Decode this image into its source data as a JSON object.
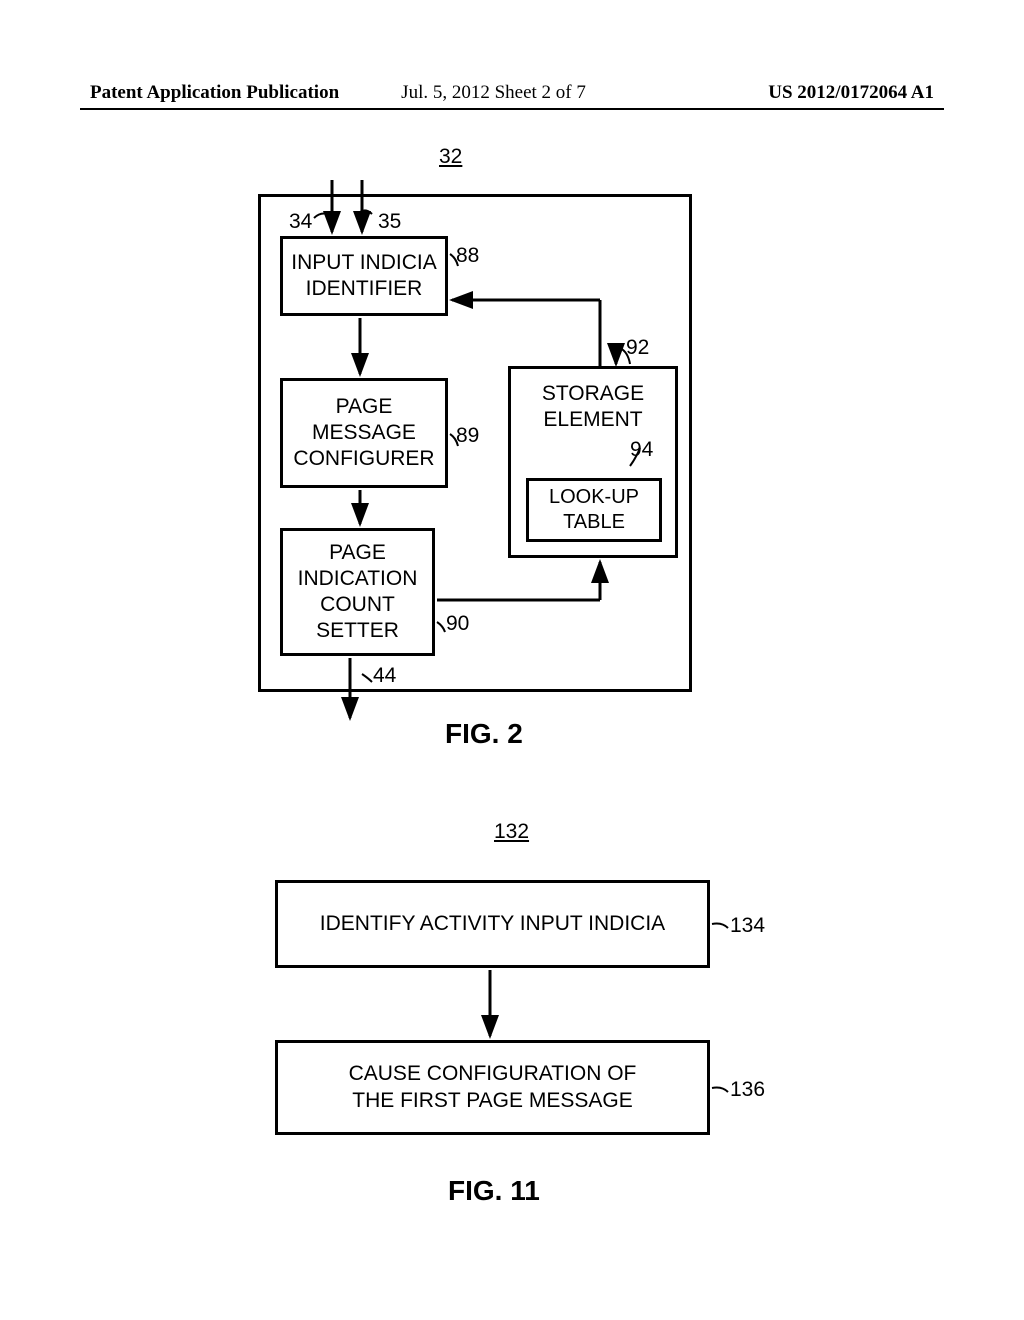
{
  "header": {
    "left": "Patent Application Publication",
    "center": "Jul. 5, 2012   Sheet 2 of 7",
    "right": "US 2012/0172064 A1"
  },
  "fig2": {
    "ref_main": "32",
    "ref_input1": "34",
    "ref_input2": "35",
    "ref_identifier": "88",
    "ref_configurer": "89",
    "ref_setter": "90",
    "ref_storage": "92",
    "ref_lookup": "94",
    "ref_output": "44",
    "box_identifier": "INPUT INDICIA\nIDENTIFIER",
    "box_configurer": "PAGE\nMESSAGE\nCONFIGURER",
    "box_setter": "PAGE\nINDICATION\nCOUNT\nSETTER",
    "box_storage": "STORAGE\nELEMENT",
    "box_lookup": "LOOK-UP\nTABLE",
    "caption": "FIG. 2"
  },
  "fig11": {
    "ref_main": "132",
    "ref_step1": "134",
    "ref_step2": "136",
    "box_step1": "IDENTIFY ACTIVITY INPUT INDICIA",
    "box_step2": "CAUSE CONFIGURATION OF\nTHE FIRST PAGE MESSAGE",
    "caption": "FIG. 11"
  }
}
